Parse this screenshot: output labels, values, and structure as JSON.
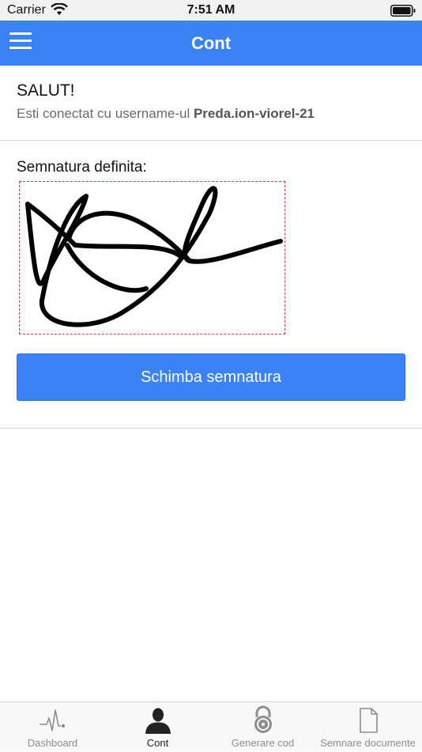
{
  "status_bar": {
    "carrier": "Carrier",
    "time": "7:51 AM",
    "icons": [
      "wifi-icon",
      "battery-icon"
    ]
  },
  "nav_bar": {
    "title": "Cont",
    "menu_icon": "hamburger-menu-icon",
    "background": "#3b82f6"
  },
  "account": {
    "greeting": "SALUT!",
    "connected_prefix": "Esti conectat cu username-ul",
    "username": "Preda.ion-viorel-21"
  },
  "signature": {
    "label": "Semnatura definita:",
    "border_color": "#e53935"
  },
  "actions": {
    "change_signature_label": "Schimba semnatura",
    "accent": "#3b82f6"
  },
  "tab_bar": {
    "items": [
      {
        "label": "Dashboard",
        "icon": "pulse-icon",
        "active": false
      },
      {
        "label": "Cont",
        "icon": "user-icon",
        "active": true
      },
      {
        "label": "Generare cod",
        "icon": "padlock-icon",
        "active": false
      },
      {
        "label": "Semnare documente",
        "icon": "document-icon",
        "active": false
      }
    ]
  }
}
